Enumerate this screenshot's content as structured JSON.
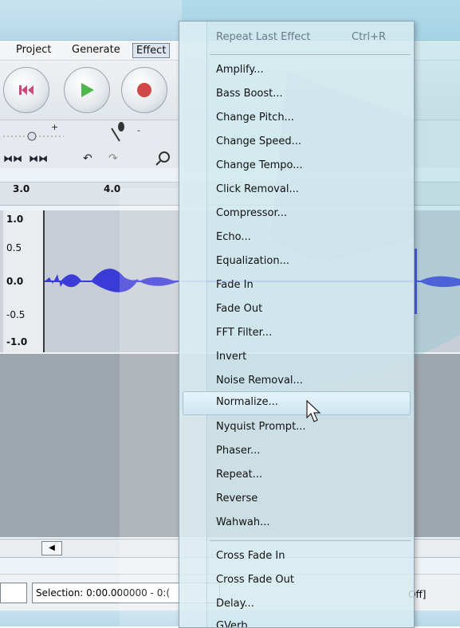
{
  "menubar": {
    "items": [
      {
        "label": "Project"
      },
      {
        "label": "Generate"
      },
      {
        "label": "Effect"
      }
    ]
  },
  "ruler": {
    "ticks": [
      "3.0",
      "4.0"
    ]
  },
  "track": {
    "scale": [
      "1.0",
      "0.5",
      "0.0",
      "-0.5",
      "-1.0"
    ]
  },
  "status": {
    "selection": "Selection: 0:00.000000 - 0:(",
    "snap_fragment": "Off]"
  },
  "effect_menu": {
    "repeat_last": {
      "label": "Repeat Last Effect",
      "shortcut": "Ctrl+R"
    },
    "items": [
      "Amplify...",
      "Bass Boost...",
      "Change Pitch...",
      "Change Speed...",
      "Change Tempo...",
      "Click Removal...",
      "Compressor...",
      "Echo...",
      "Equalization...",
      "Fade In",
      "Fade Out",
      "FFT Filter...",
      "Invert",
      "Noise Removal...",
      "Normalize...",
      "Nyquist Prompt...",
      "Phaser...",
      "Repeat...",
      "Reverse",
      "Wahwah..."
    ],
    "items2": [
      "Cross Fade In",
      "Cross Fade Out",
      "Delay...",
      "GVerb..."
    ],
    "highlighted": "Normalize..."
  },
  "colors": {
    "waveform": "#3b3bd8",
    "highlight": "#cde6f3"
  }
}
